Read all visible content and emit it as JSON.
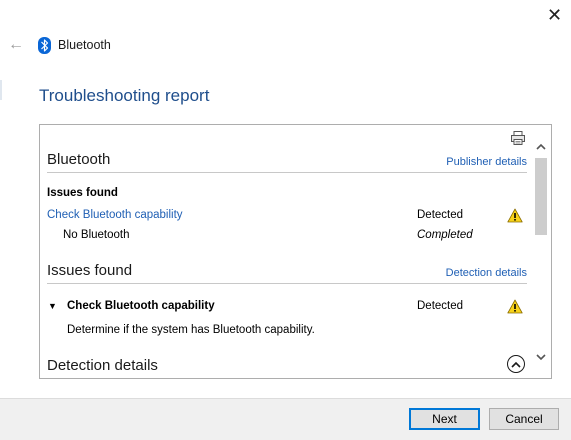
{
  "window": {
    "close_glyph": "✕",
    "back_glyph": "←",
    "app_title": "Bluetooth",
    "app_icon": "bluetooth-icon",
    "accent_color": "#1f4e8c",
    "link_color": "#1f5fb4"
  },
  "page": {
    "heading": "Troubleshooting report"
  },
  "report": {
    "section_bluetooth": {
      "title": "Bluetooth",
      "link": "Publisher details"
    },
    "issues_found_table": {
      "header": "Issues found",
      "rows": [
        {
          "name": "Check Bluetooth capability",
          "status": "Detected",
          "icon": "warning-icon"
        },
        {
          "name": "No Bluetooth",
          "status": "Completed"
        }
      ]
    },
    "section_issues": {
      "title": "Issues found",
      "link": "Detection details",
      "expander_glyph": "▼",
      "item_title": "Check Bluetooth capability",
      "item_status": "Detected",
      "item_icon": "warning-icon",
      "item_description": "Determine if the system has Bluetooth capability."
    },
    "section_detection": {
      "title": "Detection details"
    }
  },
  "footer": {
    "next_label": "Next",
    "cancel_label": "Cancel"
  }
}
